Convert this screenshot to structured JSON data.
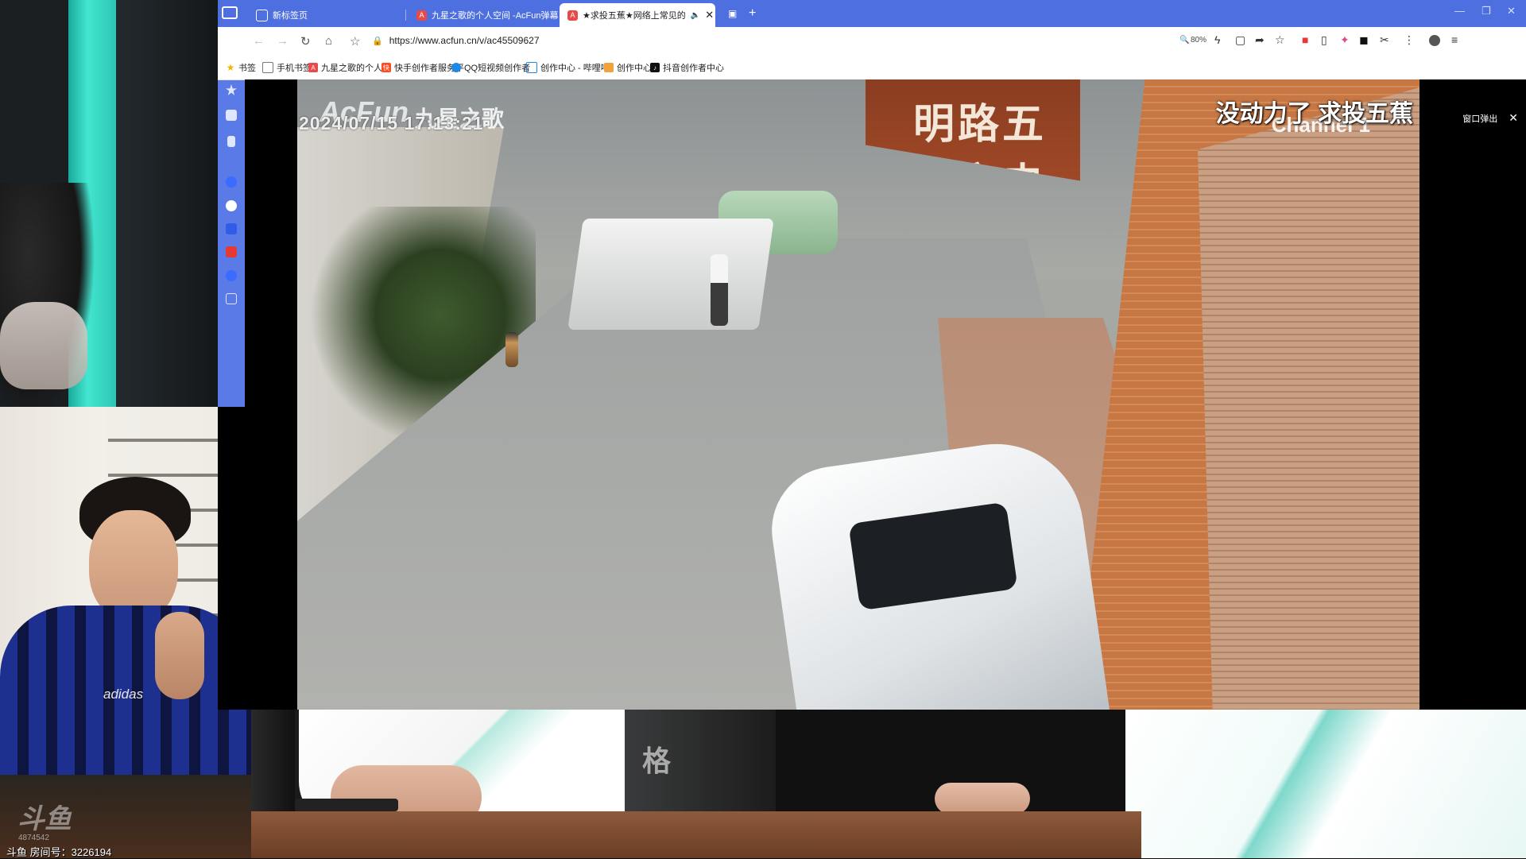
{
  "browser": {
    "tabs": [
      {
        "label": "新标签页",
        "active": false
      },
      {
        "label": "九星之歌的个人空间 -AcFun弹幕",
        "active": false
      },
      {
        "label": "★求投五蕉★网络上常见的",
        "active": true
      }
    ],
    "address_bar": {
      "url": "https://www.acfun.cn/v/ac45509627"
    },
    "zoom": "80%",
    "bookmarks": [
      {
        "label": "书签",
        "icon": "star-icon"
      },
      {
        "label": "手机书签",
        "icon": "phone-icon"
      },
      {
        "label": "九星之歌的个人空",
        "icon": "acfun-icon"
      },
      {
        "label": "快手创作者服务平",
        "icon": "kuaishou-icon"
      },
      {
        "label": "QQ短视频创作者",
        "icon": "qq-icon"
      },
      {
        "label": "创作中心 - 哔哩哔",
        "icon": "bilibili-icon"
      },
      {
        "label": "创作中心",
        "icon": "creator-icon"
      },
      {
        "label": "抖音创作者中心",
        "icon": "tiktok-icon"
      }
    ]
  },
  "video": {
    "osd_timestamp": "2024/07/15 17:13:21",
    "osd_channel": "Channel 1",
    "acfun_watermark": "AcFun",
    "uploader_watermark": "九星之歌",
    "overlay_caption": "没动力了 求投五蕉",
    "shop_sign": "明路五金交电",
    "popout_label": "窗口弹出"
  },
  "stream": {
    "platform_logo": "斗鱼",
    "watermark_number": "4874542",
    "room_id_label": "斗鱼 房间号：3226194",
    "shirt_brand": "adidas",
    "chair_text": "格"
  },
  "colors": {
    "tabbar": "#4e6fe0",
    "sidebar": "#5a7ae8",
    "acfun_red": "#e84a4a"
  }
}
